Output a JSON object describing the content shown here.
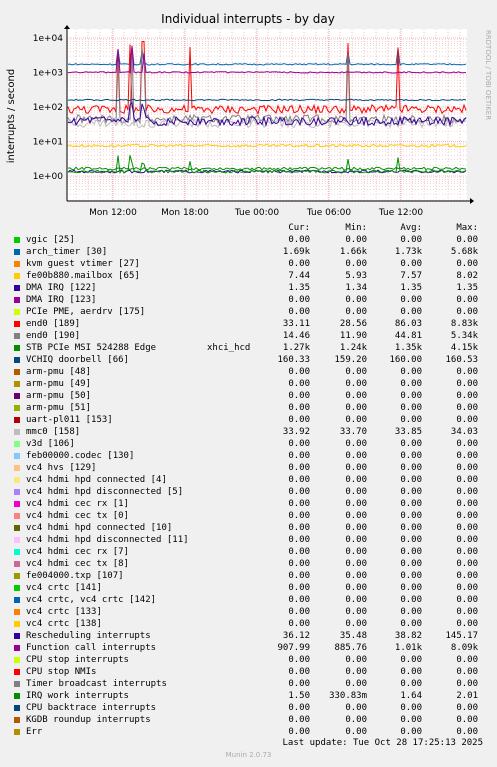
{
  "chart_data": {
    "type": "line",
    "title": "Individual interrupts - by day",
    "ylabel": "interrupts / second",
    "yscale": "log",
    "ylim": [
      0.1,
      20000
    ],
    "yticks": [
      "1e+04",
      "1e+03",
      "1e+02",
      "1e+01",
      "1e+00"
    ],
    "xticks": [
      "Mon 12:00",
      "Mon 18:00",
      "Tue 00:00",
      "Tue 06:00",
      "Tue 12:00"
    ],
    "grid": true,
    "series": [
      {
        "name": "vgic [25]",
        "color": "#00cc00",
        "values": [
          0.0,
          0.0,
          0.0,
          0.0
        ]
      },
      {
        "name": "arch_timer [30]",
        "color": "#0066b3",
        "values": [
          1690,
          1660,
          1730,
          5680
        ]
      },
      {
        "name": "kvm guest vtimer [27]",
        "color": "#ff8000",
        "values": [
          0.0,
          0.0,
          0.0,
          0.0
        ]
      },
      {
        "name": "fe00b880.mailbox [65]",
        "color": "#ffcc00",
        "values": [
          7.44,
          5.93,
          7.57,
          8.02
        ]
      },
      {
        "name": "DMA IRQ [122]",
        "color": "#330099",
        "values": [
          1.35,
          1.34,
          1.35,
          1.35
        ]
      },
      {
        "name": "DMA IRQ [123]",
        "color": "#990099",
        "values": [
          0.0,
          0.0,
          0.0,
          0.0
        ]
      },
      {
        "name": "PCIe PME, aerdrv [175]",
        "color": "#ccff00",
        "values": [
          0.0,
          0.0,
          0.0,
          0.0
        ]
      },
      {
        "name": "end0 [189]",
        "color": "#ff0000",
        "values": [
          33.11,
          28.56,
          86.03,
          8830
        ]
      },
      {
        "name": "end0 [190]",
        "color": "#808080",
        "values": [
          14.46,
          11.9,
          44.81,
          5340
        ]
      },
      {
        "name": "STB PCIe MSI 524288 Edge",
        "extra": "xhci_hcd",
        "color": "#008f00",
        "values": [
          1.27,
          1.24,
          1.35,
          4.15
        ]
      },
      {
        "name": "VCHIQ doorbell [66]",
        "color": "#00487d",
        "values": [
          160.33,
          159.2,
          160.0,
          160.53
        ]
      },
      {
        "name": "arm-pmu [48]",
        "color": "#b35a00",
        "values": [
          0.0,
          0.0,
          0.0,
          0.0
        ]
      },
      {
        "name": "arm-pmu [49]",
        "color": "#b38f00",
        "values": [
          0.0,
          0.0,
          0.0,
          0.0
        ]
      },
      {
        "name": "arm-pmu [50]",
        "color": "#6b006b",
        "values": [
          0.0,
          0.0,
          0.0,
          0.0
        ]
      },
      {
        "name": "arm-pmu [51]",
        "color": "#8fb300",
        "values": [
          0.0,
          0.0,
          0.0,
          0.0
        ]
      },
      {
        "name": "uart-pl011 [153]",
        "color": "#b30000",
        "values": [
          0.0,
          0.0,
          0.0,
          0.0
        ]
      },
      {
        "name": "mmc0 [158]",
        "color": "#bebebe",
        "values": [
          33.92,
          33.7,
          33.85,
          34.03
        ]
      },
      {
        "name": "v3d [106]",
        "color": "#80ff80",
        "values": [
          0.0,
          0.0,
          0.0,
          0.0
        ]
      },
      {
        "name": "feb00000.codec [130]",
        "color": "#80c9ff",
        "values": [
          0.0,
          0.0,
          0.0,
          0.0
        ]
      },
      {
        "name": "vc4 hvs [129]",
        "color": "#ffc080",
        "values": [
          0.0,
          0.0,
          0.0,
          0.0
        ]
      },
      {
        "name": "vc4 hdmi hpd connected [4]",
        "color": "#ffe680",
        "values": [
          0.0,
          0.0,
          0.0,
          0.0
        ]
      },
      {
        "name": "vc4 hdmi hpd disconnected [5]",
        "color": "#aa80ff",
        "values": [
          0.0,
          0.0,
          0.0,
          0.0
        ]
      },
      {
        "name": "vc4 hdmi cec rx [1]",
        "color": "#ee00cc",
        "values": [
          0.0,
          0.0,
          0.0,
          0.0
        ]
      },
      {
        "name": "vc4 hdmi cec tx [0]",
        "color": "#ff8080",
        "values": [
          0.0,
          0.0,
          0.0,
          0.0
        ]
      },
      {
        "name": "vc4 hdmi hpd connected [10]",
        "color": "#666600",
        "values": [
          0.0,
          0.0,
          0.0,
          0.0
        ]
      },
      {
        "name": "vc4 hdmi hpd disconnected [11]",
        "color": "#ffbfff",
        "values": [
          0.0,
          0.0,
          0.0,
          0.0
        ]
      },
      {
        "name": "vc4 hdmi cec rx [7]",
        "color": "#00ffcc",
        "values": [
          0.0,
          0.0,
          0.0,
          0.0
        ]
      },
      {
        "name": "vc4 hdmi cec tx [8]",
        "color": "#cc6699",
        "values": [
          0.0,
          0.0,
          0.0,
          0.0
        ]
      },
      {
        "name": "fe004000.txp [107]",
        "color": "#999900",
        "values": [
          0.0,
          0.0,
          0.0,
          0.0
        ]
      },
      {
        "name": "vc4 crtc [141]",
        "color": "#00cc00",
        "values": [
          0.0,
          0.0,
          0.0,
          0.0
        ]
      },
      {
        "name": "vc4 crtc, vc4 crtc [142]",
        "color": "#0066b3",
        "values": [
          0.0,
          0.0,
          0.0,
          0.0
        ]
      },
      {
        "name": "vc4 crtc [133]",
        "color": "#ff8000",
        "values": [
          0.0,
          0.0,
          0.0,
          0.0
        ]
      },
      {
        "name": "vc4 crtc [138]",
        "color": "#ffcc00",
        "values": [
          0.0,
          0.0,
          0.0,
          0.0
        ]
      },
      {
        "name": "Rescheduling interrupts",
        "color": "#330099",
        "values": [
          36.12,
          35.48,
          38.82,
          145.17
        ]
      },
      {
        "name": "Function call interrupts",
        "color": "#990099",
        "values": [
          907.99,
          885.76,
          1010,
          8090
        ]
      },
      {
        "name": "CPU stop interrupts",
        "color": "#ccff00",
        "values": [
          0.0,
          0.0,
          0.0,
          0.0
        ]
      },
      {
        "name": "CPU stop NMIs",
        "color": "#ff0000",
        "values": [
          0.0,
          0.0,
          0.0,
          0.0
        ]
      },
      {
        "name": "Timer broadcast interrupts",
        "color": "#808080",
        "values": [
          0.0,
          0.0,
          0.0,
          0.0
        ]
      },
      {
        "name": "IRQ work interrupts",
        "color": "#008f00",
        "values": [
          1.5,
          0.33083,
          1.64,
          2.01
        ]
      },
      {
        "name": "CPU backtrace interrupts",
        "color": "#00487d",
        "values": [
          0.0,
          0.0,
          0.0,
          0.0
        ]
      },
      {
        "name": "KGDB roundup interrupts",
        "color": "#b35a00",
        "values": [
          0.0,
          0.0,
          0.0,
          0.0
        ]
      },
      {
        "name": "Err",
        "color": "#b38f00",
        "values": [
          0.0,
          0.0,
          0.0,
          0.0
        ]
      }
    ]
  },
  "legend": {
    "headers": [
      "Cur:",
      "Min:",
      "Avg:",
      "Max:"
    ],
    "rows": [
      {
        "name": "vgic [25]",
        "color": "#00cc00",
        "cur": "0.00",
        "min": "0.00",
        "avg": "0.00",
        "max": "0.00"
      },
      {
        "name": "arch_timer [30]",
        "color": "#0066b3",
        "cur": "1.69k",
        "min": "1.66k",
        "avg": "1.73k",
        "max": "5.68k"
      },
      {
        "name": "kvm guest vtimer [27]",
        "color": "#ff8000",
        "cur": "0.00",
        "min": "0.00",
        "avg": "0.00",
        "max": "0.00"
      },
      {
        "name": "fe00b880.mailbox [65]",
        "color": "#ffcc00",
        "cur": "7.44",
        "min": "5.93",
        "avg": "7.57",
        "max": "8.02"
      },
      {
        "name": "DMA IRQ [122]",
        "color": "#330099",
        "cur": "1.35",
        "min": "1.34",
        "avg": "1.35",
        "max": "1.35"
      },
      {
        "name": "DMA IRQ [123]",
        "color": "#990099",
        "cur": "0.00",
        "min": "0.00",
        "avg": "0.00",
        "max": "0.00"
      },
      {
        "name": "PCIe PME, aerdrv [175]",
        "color": "#ccff00",
        "cur": "0.00",
        "min": "0.00",
        "avg": "0.00",
        "max": "0.00"
      },
      {
        "name": "end0 [189]",
        "color": "#ff0000",
        "cur": "33.11",
        "min": "28.56",
        "avg": "86.03",
        "max": "8.83k"
      },
      {
        "name": "end0 [190]",
        "color": "#808080",
        "cur": "14.46",
        "min": "11.90",
        "avg": "44.81",
        "max": "5.34k"
      },
      {
        "name": "STB PCIe MSI 524288 Edge",
        "extra": "xhci_hcd",
        "color": "#008f00",
        "cur": "1.27k",
        "min": "1.24k",
        "avg": "1.35k",
        "max": "4.15k"
      },
      {
        "name": "VCHIQ doorbell [66]",
        "color": "#00487d",
        "cur": "160.33",
        "min": "159.20",
        "avg": "160.00",
        "max": "160.53"
      },
      {
        "name": "arm-pmu [48]",
        "color": "#b35a00",
        "cur": "0.00",
        "min": "0.00",
        "avg": "0.00",
        "max": "0.00"
      },
      {
        "name": "arm-pmu [49]",
        "color": "#b38f00",
        "cur": "0.00",
        "min": "0.00",
        "avg": "0.00",
        "max": "0.00"
      },
      {
        "name": "arm-pmu [50]",
        "color": "#6b006b",
        "cur": "0.00",
        "min": "0.00",
        "avg": "0.00",
        "max": "0.00"
      },
      {
        "name": "arm-pmu [51]",
        "color": "#8fb300",
        "cur": "0.00",
        "min": "0.00",
        "avg": "0.00",
        "max": "0.00"
      },
      {
        "name": "uart-pl011 [153]",
        "color": "#b30000",
        "cur": "0.00",
        "min": "0.00",
        "avg": "0.00",
        "max": "0.00"
      },
      {
        "name": "mmc0 [158]",
        "color": "#bebebe",
        "cur": "33.92",
        "min": "33.70",
        "avg": "33.85",
        "max": "34.03"
      },
      {
        "name": "v3d [106]",
        "color": "#80ff80",
        "cur": "0.00",
        "min": "0.00",
        "avg": "0.00",
        "max": "0.00"
      },
      {
        "name": "feb00000.codec [130]",
        "color": "#80c9ff",
        "cur": "0.00",
        "min": "0.00",
        "avg": "0.00",
        "max": "0.00"
      },
      {
        "name": "vc4 hvs [129]",
        "color": "#ffc080",
        "cur": "0.00",
        "min": "0.00",
        "avg": "0.00",
        "max": "0.00"
      },
      {
        "name": "vc4 hdmi hpd connected [4]",
        "color": "#ffe680",
        "cur": "0.00",
        "min": "0.00",
        "avg": "0.00",
        "max": "0.00"
      },
      {
        "name": "vc4 hdmi hpd disconnected [5]",
        "color": "#aa80ff",
        "cur": "0.00",
        "min": "0.00",
        "avg": "0.00",
        "max": "0.00"
      },
      {
        "name": "vc4 hdmi cec rx [1]",
        "color": "#ee00cc",
        "cur": "0.00",
        "min": "0.00",
        "avg": "0.00",
        "max": "0.00"
      },
      {
        "name": "vc4 hdmi cec tx [0]",
        "color": "#ff8080",
        "cur": "0.00",
        "min": "0.00",
        "avg": "0.00",
        "max": "0.00"
      },
      {
        "name": "vc4 hdmi hpd connected [10]",
        "color": "#666600",
        "cur": "0.00",
        "min": "0.00",
        "avg": "0.00",
        "max": "0.00"
      },
      {
        "name": "vc4 hdmi hpd disconnected [11]",
        "color": "#ffbfff",
        "cur": "0.00",
        "min": "0.00",
        "avg": "0.00",
        "max": "0.00"
      },
      {
        "name": "vc4 hdmi cec rx [7]",
        "color": "#00ffcc",
        "cur": "0.00",
        "min": "0.00",
        "avg": "0.00",
        "max": "0.00"
      },
      {
        "name": "vc4 hdmi cec tx [8]",
        "color": "#cc6699",
        "cur": "0.00",
        "min": "0.00",
        "avg": "0.00",
        "max": "0.00"
      },
      {
        "name": "fe004000.txp [107]",
        "color": "#999900",
        "cur": "0.00",
        "min": "0.00",
        "avg": "0.00",
        "max": "0.00"
      },
      {
        "name": "vc4 crtc [141]",
        "color": "#00cc00",
        "cur": "0.00",
        "min": "0.00",
        "avg": "0.00",
        "max": "0.00"
      },
      {
        "name": "vc4 crtc, vc4 crtc [142]",
        "color": "#0066b3",
        "cur": "0.00",
        "min": "0.00",
        "avg": "0.00",
        "max": "0.00"
      },
      {
        "name": "vc4 crtc [133]",
        "color": "#ff8000",
        "cur": "0.00",
        "min": "0.00",
        "avg": "0.00",
        "max": "0.00"
      },
      {
        "name": "vc4 crtc [138]",
        "color": "#ffcc00",
        "cur": "0.00",
        "min": "0.00",
        "avg": "0.00",
        "max": "0.00"
      },
      {
        "name": "Rescheduling interrupts",
        "color": "#330099",
        "cur": "36.12",
        "min": "35.48",
        "avg": "38.82",
        "max": "145.17"
      },
      {
        "name": "Function call interrupts",
        "color": "#990099",
        "cur": "907.99",
        "min": "885.76",
        "avg": "1.01k",
        "max": "8.09k"
      },
      {
        "name": "CPU stop interrupts",
        "color": "#ccff00",
        "cur": "0.00",
        "min": "0.00",
        "avg": "0.00",
        "max": "0.00"
      },
      {
        "name": "CPU stop NMIs",
        "color": "#ff0000",
        "cur": "0.00",
        "min": "0.00",
        "avg": "0.00",
        "max": "0.00"
      },
      {
        "name": "Timer broadcast interrupts",
        "color": "#808080",
        "cur": "0.00",
        "min": "0.00",
        "avg": "0.00",
        "max": "0.00"
      },
      {
        "name": "IRQ work interrupts",
        "color": "#008f00",
        "cur": "1.50",
        "min": "330.83m",
        "avg": "1.64",
        "max": "2.01"
      },
      {
        "name": "CPU backtrace interrupts",
        "color": "#00487d",
        "cur": "0.00",
        "min": "0.00",
        "avg": "0.00",
        "max": "0.00"
      },
      {
        "name": "KGDB roundup interrupts",
        "color": "#b35a00",
        "cur": "0.00",
        "min": "0.00",
        "avg": "0.00",
        "max": "0.00"
      },
      {
        "name": "Err",
        "color": "#b38f00",
        "cur": "0.00",
        "min": "0.00",
        "avg": "0.00",
        "max": "0.00"
      }
    ]
  },
  "side_text": "RRDTOOL / TOBI OETIKER",
  "footer": {
    "last_update": "Last update: Tue Oct 28 17:25:13 2025",
    "munin": "Munin 2.0.73"
  }
}
